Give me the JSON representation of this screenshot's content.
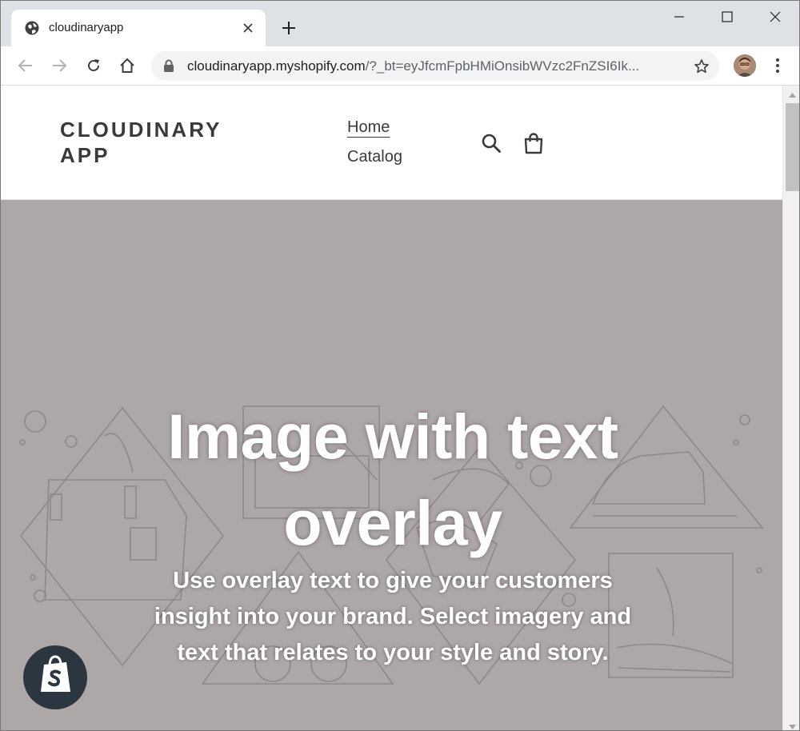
{
  "browser": {
    "tab_title": "cloudinaryapp",
    "url_host": "cloudinaryapp.myshopify.com",
    "url_rest": "/?_bt=eyJfcmFpbHMiOnsibWVzc2FnZSI6Ik..."
  },
  "site": {
    "logo": "CLOUDINARY APP",
    "nav": [
      {
        "label": "Home",
        "active": true
      },
      {
        "label": "Catalog",
        "active": false
      }
    ]
  },
  "hero": {
    "title": "Image with text overlay",
    "text": "Use overlay text to give your customers insight into your brand. Select imagery and text that relates to your style and story."
  },
  "icons": {
    "favicon": "globe-icon",
    "search": "search-icon",
    "cart": "shopping-bag-icon",
    "badge": "shopify-logo-icon"
  },
  "colors": {
    "hero_bg": "#aea7a8",
    "tabstrip": "#dee1e6",
    "text_dark": "#3a3a3a",
    "badge": "#2c3641"
  }
}
